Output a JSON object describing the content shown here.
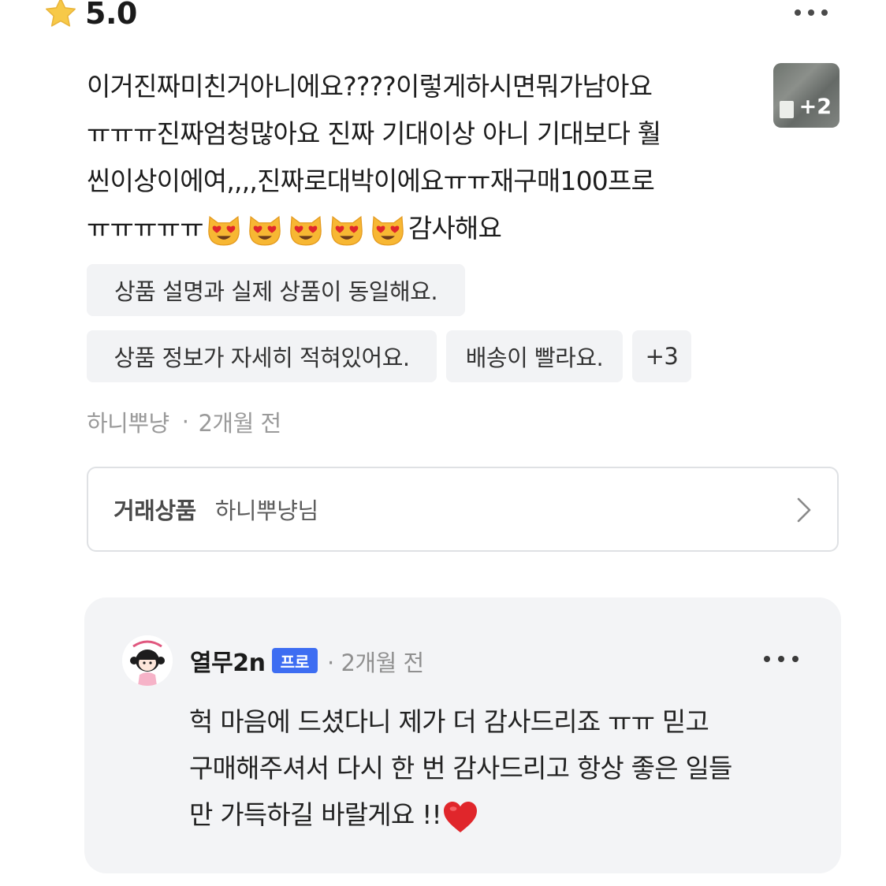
{
  "rating": {
    "value": "5.0",
    "icon": "star-icon",
    "color": "#f5c518"
  },
  "review": {
    "text": "이거진짜미친거아니에요????이렇게하시면뭐가남아요\nㅠㅠㅠ진짜엄청많아요 진짜 기대이상 아니 기대보다 훨\n씬이상이에여,,,,진짜로대박이에요ㅠㅠ재구매100프로\nㅠㅠㅠㅠㅠ",
    "emoji_count": 5,
    "emoji": "heart-eyes-cat-icon",
    "text_end": "감사해요",
    "photo_more": "+2"
  },
  "tags": [
    "상품 설명과 실제 상품이 동일해요.",
    "상품 정보가 자세히 적혀있어요.",
    "배송이 빨라요.",
    "+3"
  ],
  "meta": {
    "author": "하니뿌냥",
    "separator": "·",
    "time": "2개월 전"
  },
  "product": {
    "label": "거래상품",
    "name": "하니뿌냥님"
  },
  "reply": {
    "seller": "열무2n",
    "badge": "프로",
    "separator": "·",
    "time": "2개월 전",
    "text": "헉 마음에 드셨다니 제가 더 감사드리죠 ㅠㅠ 믿고\n구매해주셔서 다시 한 번 감사드리고 항상 좋은 일들\n만 가득하길 바랄게요 !!",
    "heart": "red-heart-icon",
    "heart_color": "#e0262b"
  },
  "colors": {
    "accent": "#3d6df2",
    "tag_bg": "#f2f3f5",
    "reply_bg": "#f3f4f6"
  }
}
